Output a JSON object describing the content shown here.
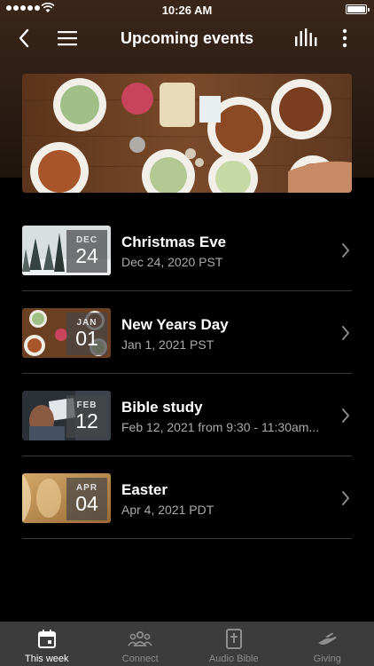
{
  "status_bar": {
    "time": "10:26 AM"
  },
  "nav": {
    "title": "Upcoming events"
  },
  "events": [
    {
      "month": "DEC",
      "day": "24",
      "name": "Christmas Eve",
      "sub": "Dec 24, 2020 PST"
    },
    {
      "month": "JAN",
      "day": "01",
      "name": "New Years Day",
      "sub": "Jan 1, 2021 PST"
    },
    {
      "month": "FEB",
      "day": "12",
      "name": "Bible study",
      "sub": "Feb 12, 2021 from 9:30 - 11:30am..."
    },
    {
      "month": "APR",
      "day": "04",
      "name": "Easter",
      "sub": "Apr 4, 2021 PDT"
    }
  ],
  "tabs": [
    {
      "label": "This week",
      "icon": "calendar-icon",
      "active": true
    },
    {
      "label": "Connect",
      "icon": "people-icon",
      "active": false
    },
    {
      "label": "Audio Bible",
      "icon": "bible-icon",
      "active": false
    },
    {
      "label": "Giving",
      "icon": "giving-hand-icon",
      "active": false
    }
  ],
  "colors": {
    "header_brown": "#3a2619",
    "tabbar": "#3c3c3c",
    "secondary_text": "#aaaaaa"
  }
}
